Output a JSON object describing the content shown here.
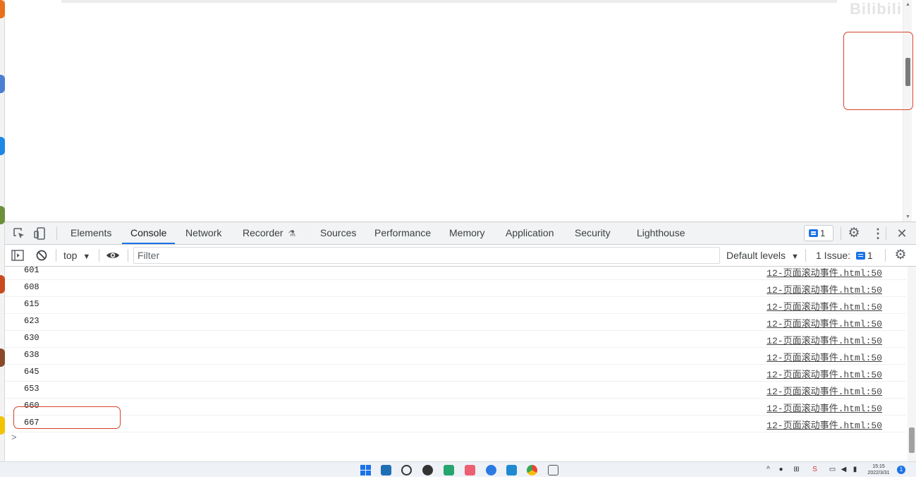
{
  "watermark": "Bilibili",
  "devtools": {
    "tabs": [
      {
        "label": "Elements"
      },
      {
        "label": "Console"
      },
      {
        "label": "Network"
      },
      {
        "label": "Recorder"
      },
      {
        "label": "Sources"
      },
      {
        "label": "Performance"
      },
      {
        "label": "Memory"
      },
      {
        "label": "Application"
      },
      {
        "label": "Security"
      },
      {
        "label": "Lighthouse"
      }
    ],
    "active_tab": "Console",
    "issues_count": "1",
    "toolbar": {
      "context": "top",
      "filter_placeholder": "Filter",
      "levels": "Default levels",
      "issue_label": "1 Issue:",
      "issue_count": "1"
    }
  },
  "console": {
    "rows": [
      {
        "value": "601",
        "source": "12-页面滚动事件.html:50"
      },
      {
        "value": "608",
        "source": "12-页面滚动事件.html:50"
      },
      {
        "value": "615",
        "source": "12-页面滚动事件.html:50"
      },
      {
        "value": "623",
        "source": "12-页面滚动事件.html:50"
      },
      {
        "value": "630",
        "source": "12-页面滚动事件.html:50"
      },
      {
        "value": "638",
        "source": "12-页面滚动事件.html:50"
      },
      {
        "value": "645",
        "source": "12-页面滚动事件.html:50"
      },
      {
        "value": "653",
        "source": "12-页面滚动事件.html:50"
      },
      {
        "value": "660",
        "source": "12-页面滚动事件.html:50"
      },
      {
        "value": "667",
        "source": "12-页面滚动事件.html:50"
      }
    ],
    "prompt": ">"
  },
  "taskbar": {
    "clock_time": "15:15",
    "clock_date": "2022/3/31",
    "notifications": "1"
  },
  "colors": {
    "accent": "#1a73e8",
    "highlight": "#d4412a"
  }
}
